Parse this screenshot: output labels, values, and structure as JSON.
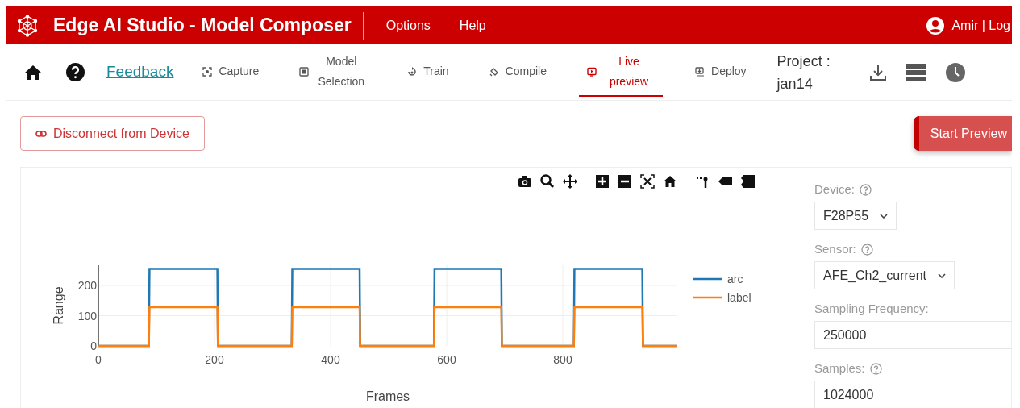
{
  "header": {
    "title": "Edge AI Studio - Model Composer",
    "menu": [
      "Options",
      "Help"
    ],
    "user": "Amir | Log"
  },
  "toolbar": {
    "feedback": "Feedback",
    "tabs": [
      {
        "label": "Capture",
        "selected": false
      },
      {
        "label": "Model Selection",
        "selected": false
      },
      {
        "label": "Train",
        "selected": false
      },
      {
        "label": "Compile",
        "selected": false
      },
      {
        "label": "Live preview",
        "selected": true
      },
      {
        "label": "Deploy",
        "selected": false
      }
    ],
    "project_label": "Project :",
    "project_name": "jan14"
  },
  "actions": {
    "disconnect": "Disconnect from Device",
    "start_preview": "Start Preview"
  },
  "settings": {
    "fields": [
      {
        "kind": "select",
        "label": "Device:",
        "help": true,
        "value": "F28P55"
      },
      {
        "kind": "select",
        "label": "Sensor:",
        "help": true,
        "value": "AFE_Ch2_current"
      },
      {
        "kind": "input",
        "label": "Sampling Frequency:",
        "help": false,
        "value": "250000"
      },
      {
        "kind": "input",
        "label": "Samples:",
        "help": true,
        "value": "1024000"
      }
    ]
  },
  "chart": {
    "chart_data": {
      "type": "line",
      "xlabel": "Frames",
      "ylabel": "Range",
      "x": [
        0,
        87,
        88,
        205,
        206,
        333,
        334,
        450,
        451,
        578,
        579,
        694,
        695,
        819,
        820,
        937,
        938,
        997
      ],
      "series": [
        {
          "name": "arc",
          "color": "#1f77b4",
          "values": [
            0,
            0,
            255,
            255,
            0,
            0,
            255,
            255,
            0,
            0,
            255,
            255,
            0,
            0,
            255,
            255,
            0,
            0
          ]
        },
        {
          "name": "label",
          "color": "#ff7f0e",
          "values": [
            0,
            0,
            128,
            128,
            0,
            0,
            128,
            128,
            0,
            0,
            128,
            128,
            0,
            0,
            128,
            128,
            0,
            0
          ]
        }
      ],
      "grid": true,
      "legend": true,
      "xlim": [
        0,
        997
      ],
      "ylim": [
        0,
        267
      ],
      "xticks": [
        0,
        200,
        400,
        600,
        800
      ],
      "yticks": [
        0,
        100,
        200
      ]
    }
  }
}
